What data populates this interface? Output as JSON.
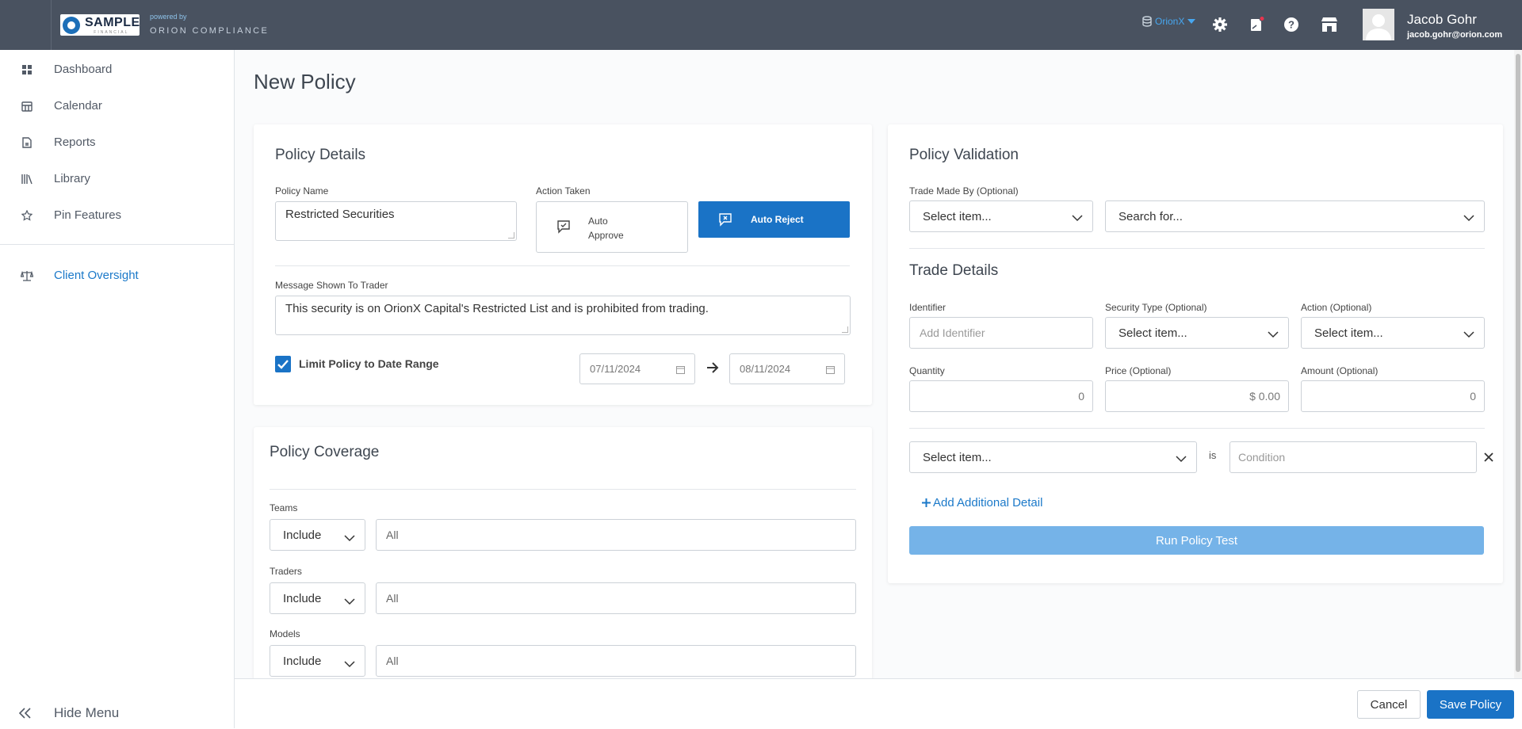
{
  "header": {
    "logo_text": "SAMPLE",
    "logo_sub": "FINANCIAL",
    "powered_by": "powered by",
    "product": "ORION COMPLIANCE",
    "firm": "OrionX",
    "user_name": "Jacob Gohr",
    "user_email": "jacob.gohr@orion.com"
  },
  "sidebar": {
    "items": [
      {
        "label": "Dashboard",
        "icon": "dashboard-icon"
      },
      {
        "label": "Calendar",
        "icon": "calendar-icon"
      },
      {
        "label": "Reports",
        "icon": "report-icon"
      },
      {
        "label": "Library",
        "icon": "library-icon"
      },
      {
        "label": "Pin Features",
        "icon": "star-icon"
      }
    ],
    "client_oversight": "Client Oversight",
    "hide_menu": "Hide Menu"
  },
  "page": {
    "title": "New Policy"
  },
  "policy_details": {
    "title": "Policy Details",
    "name_label": "Policy Name",
    "name_value": "Restricted Securities",
    "action_label": "Action Taken",
    "auto_approve": "Auto Approve",
    "auto_reject": "Auto Reject",
    "message_label": "Message Shown To Trader",
    "message_value": "This security is on OrionX Capital's Restricted List and is prohibited from trading.",
    "limit_label": "Limit Policy to Date Range",
    "limit_checked": true,
    "start_date": "07/11/2024",
    "end_date": "08/11/2024"
  },
  "policy_coverage": {
    "title": "Policy Coverage",
    "rows": [
      {
        "label": "Teams",
        "mode": "Include",
        "value": "All"
      },
      {
        "label": "Traders",
        "mode": "Include",
        "value": "All"
      },
      {
        "label": "Models",
        "mode": "Include",
        "value": "All"
      }
    ]
  },
  "validation": {
    "title": "Policy Validation",
    "trade_by_label": "Trade Made By (Optional)",
    "trade_by_placeholder": "Select item...",
    "search_placeholder": "Search for...",
    "details_title": "Trade Details",
    "identifier_label": "Identifier",
    "identifier_placeholder": "Add Identifier",
    "sectype_label": "Security Type (Optional)",
    "sectype_placeholder": "Select item...",
    "action_label": "Action (Optional)",
    "action_placeholder": "Select item...",
    "quantity_label": "Quantity",
    "quantity_value": "0",
    "price_label": "Price (Optional)",
    "price_value": "$ 0.00",
    "amount_label": "Amount (Optional)",
    "amount_value": "0",
    "cond_select": "Select item...",
    "cond_is": "is",
    "cond_placeholder": "Condition",
    "add_detail": "Add Additional Detail",
    "run_test": "Run Policy Test"
  },
  "footer": {
    "cancel": "Cancel",
    "save": "Save Policy"
  },
  "colors": {
    "topbar": "#495260",
    "accent": "#1a73c6",
    "link": "#1b79c9",
    "run_button": "#75b3e8"
  }
}
